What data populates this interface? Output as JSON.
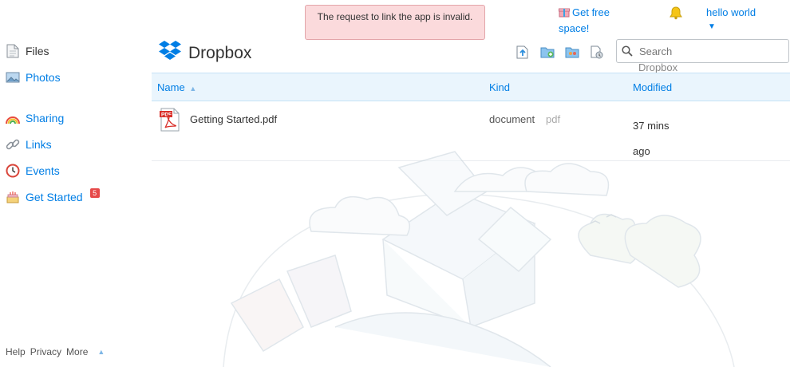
{
  "sidebar": {
    "items": [
      {
        "label": "Files",
        "icon": "files-icon"
      },
      {
        "label": "Photos",
        "icon": "photos-icon"
      },
      {
        "label": "Sharing",
        "icon": "rainbow-icon"
      },
      {
        "label": "Links",
        "icon": "chain-link-icon"
      },
      {
        "label": "Events",
        "icon": "clock-icon"
      },
      {
        "label": "Get Started",
        "icon": "cake-icon",
        "badge": "5"
      }
    ],
    "footer": [
      "Help",
      "Privacy",
      "More"
    ]
  },
  "notice": {
    "text": "The request to link the app is invalid."
  },
  "topbar": {
    "free_space": "Get free space!",
    "user": "hello world",
    "caret": "▼"
  },
  "header": {
    "brand": "Dropbox",
    "brand_color": "#007ee5"
  },
  "search": {
    "placeholder": "Search",
    "sub": "Dropbox"
  },
  "table": {
    "columns": {
      "name": "Name",
      "sort_indicator": "▲",
      "kind": "Kind",
      "modified": "Modified"
    },
    "rows": [
      {
        "name": "Getting Started.pdf",
        "kind": "document",
        "ext": "pdf",
        "modified": "37 mins ago"
      }
    ]
  }
}
